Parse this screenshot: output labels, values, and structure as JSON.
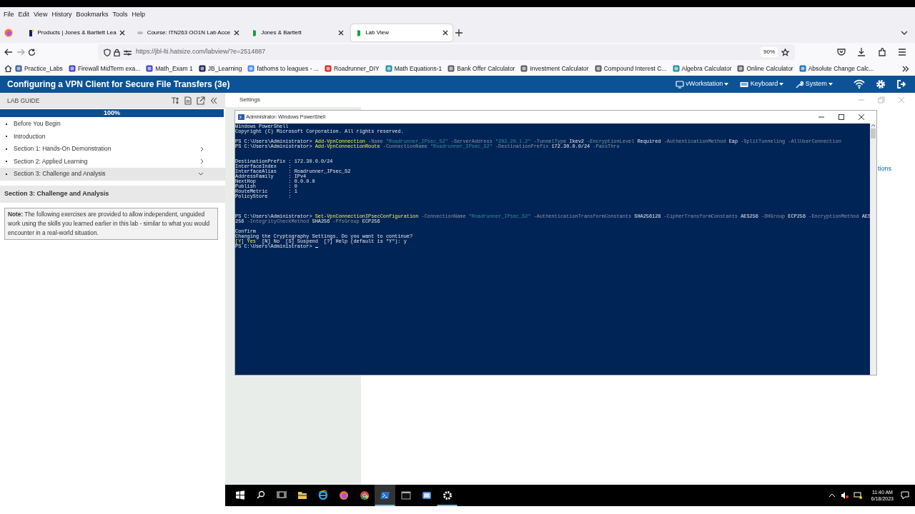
{
  "menu": [
    "File",
    "Edit",
    "View",
    "History",
    "Bookmarks",
    "Tools",
    "Help"
  ],
  "tabs": [
    {
      "title": "Products | Jones & Bartlett Lea",
      "selected": false
    },
    {
      "title": "Course: ITN263 OO1N Lab Acce",
      "selected": false
    },
    {
      "title": "Jones & Bartlett",
      "selected": false
    },
    {
      "title": "Lab View",
      "selected": true
    }
  ],
  "address": {
    "url": "https://jbl-lti.hatsize.com/labview/?e=2514887",
    "zoom": "90%"
  },
  "bookmarks": [
    {
      "label": "Practice_Labs",
      "color": "#3b5ba5"
    },
    {
      "label": "Firewall MidTerm exa...",
      "color": "#3f3fd0"
    },
    {
      "label": "Math_Exam 1",
      "color": "#3f3fd0"
    },
    {
      "label": "JB_Learning",
      "color": "#1a1a5e"
    },
    {
      "label": "fathoms to leagues - ...",
      "color": "#4285f4"
    },
    {
      "label": "Roadrunner_DIY",
      "color": "#e02020"
    },
    {
      "label": "Math Equations-1",
      "color": "#1a8fa8"
    },
    {
      "label": "Bank Offer Calculator",
      "color": "#5a5a66"
    },
    {
      "label": "Investment Calculator",
      "color": "#5a5a66"
    },
    {
      "label": "Compound Interest C...",
      "color": "#5a5a66"
    },
    {
      "label": "Algebra Calculator",
      "color": "#1a8fa8"
    },
    {
      "label": "Online Calculator",
      "color": "#5a5a66"
    },
    {
      "label": "Absolute Change Calc...",
      "color": "#1c6fb5"
    }
  ],
  "lab": {
    "title": "Configuring a VPN Client for Secure File Transfers (3e)",
    "menus": [
      "vWorkstation",
      "Keyboard",
      "System"
    ]
  },
  "guide": {
    "heading": "LAB GUIDE",
    "progress": {
      "level": 1,
      "label": "100%"
    },
    "items": [
      {
        "label": "Before You Begin",
        "expandable": false,
        "selected": false
      },
      {
        "label": "Introduction",
        "expandable": false,
        "selected": false
      },
      {
        "label": "Section 1: Hands-On Demonstration",
        "expandable": true,
        "expanded": false,
        "selected": false
      },
      {
        "label": "Section 2: Applied Learning",
        "expandable": true,
        "expanded": false,
        "selected": false
      },
      {
        "label": "Section 3: Challenge and Analysis",
        "expandable": true,
        "expanded": true,
        "selected": true
      }
    ],
    "section_title": "Section 3: Challenge and Analysis",
    "note": "**Note:** The following exercises are provided to allow independent, unguided work using the skills you learned earlier in this lab - similar to what you would encounter in a real-world situation."
  },
  "settings_window": {
    "title": "Settings",
    "partial_link": "tions"
  },
  "powershell": {
    "title": "Administrator: Windows PowerShell",
    "lines": [
      {
        "kind": "text",
        "segments": [
          {
            "kind": "text",
            "text": "Windows PowerShell"
          }
        ]
      },
      {
        "kind": "text",
        "segments": [
          {
            "kind": "text",
            "text": "Copyright (C) Microsoft Corporation. All rights reserved."
          }
        ]
      },
      {
        "kind": "blank"
      },
      {
        "kind": "text",
        "segments": [
          {
            "kind": "text",
            "text": "PS C:\\Users\\Administrator> "
          },
          {
            "kind": "command",
            "text": "Add-VpnConnection"
          },
          {
            "kind": "parameter",
            "text": " -Name "
          },
          {
            "kind": "string",
            "text": "\"Roadrunner_IPsec_S2\""
          },
          {
            "kind": "parameter",
            "text": " -ServerAddress "
          },
          {
            "kind": "string",
            "text": "\"202.20.1.2\""
          },
          {
            "kind": "parameter",
            "text": " -TunnelType "
          },
          {
            "kind": "text",
            "text": "Ikev2"
          },
          {
            "kind": "parameter",
            "text": " -EncryptionLevel "
          },
          {
            "kind": "text",
            "text": "Required"
          },
          {
            "kind": "parameter",
            "text": " -AuthenticationMethod "
          },
          {
            "kind": "text",
            "text": "Eap"
          },
          {
            "kind": "parameter",
            "text": " -SplitTunneling -AllUserConnection"
          }
        ]
      },
      {
        "kind": "text",
        "segments": [
          {
            "kind": "text",
            "text": "PS C:\\Users\\Administrator> "
          },
          {
            "kind": "command",
            "text": "Add-VpnConnectionRoute"
          },
          {
            "kind": "parameter",
            "text": " -ConnectionName "
          },
          {
            "kind": "string",
            "text": "\"Roadrunner_IPsec_S2\""
          },
          {
            "kind": "parameter",
            "text": " -DestinationPrefix "
          },
          {
            "kind": "text",
            "text": "172.30.0.0/24"
          },
          {
            "kind": "parameter",
            "text": " -PassThru"
          }
        ]
      },
      {
        "kind": "blank"
      },
      {
        "kind": "blank"
      },
      {
        "kind": "text",
        "segments": [
          {
            "kind": "text",
            "text": "DestinationPrefix : 172.30.0.0/24"
          }
        ]
      },
      {
        "kind": "text",
        "segments": [
          {
            "kind": "text",
            "text": "InterfaceIndex    :"
          }
        ]
      },
      {
        "kind": "text",
        "segments": [
          {
            "kind": "text",
            "text": "InterfaceAlias    : Roadrunner_IPsec_S2"
          }
        ]
      },
      {
        "kind": "text",
        "segments": [
          {
            "kind": "text",
            "text": "AddressFamily     : IPv4"
          }
        ]
      },
      {
        "kind": "text",
        "segments": [
          {
            "kind": "text",
            "text": "NextHop           : 0.0.0.0"
          }
        ]
      },
      {
        "kind": "text",
        "segments": [
          {
            "kind": "text",
            "text": "Publish           : 0"
          }
        ]
      },
      {
        "kind": "text",
        "segments": [
          {
            "kind": "text",
            "text": "RouteMetric       : 1"
          }
        ]
      },
      {
        "kind": "text",
        "segments": [
          {
            "kind": "text",
            "text": "PolicyStore       :"
          }
        ]
      },
      {
        "kind": "blank"
      },
      {
        "kind": "blank"
      },
      {
        "kind": "blank"
      },
      {
        "kind": "text",
        "segments": [
          {
            "kind": "text",
            "text": "PS C:\\Users\\Administrator> "
          },
          {
            "kind": "command",
            "text": "Set-VpnConnectionIPsecConfiguration"
          },
          {
            "kind": "parameter",
            "text": " -ConnectionName "
          },
          {
            "kind": "string",
            "text": "\"Roadrunner_IPsec_S2\""
          },
          {
            "kind": "parameter",
            "text": " -AuthenticationTransformConstants "
          },
          {
            "kind": "text",
            "text": "SHA256128"
          },
          {
            "kind": "parameter",
            "text": " -CipherTransformConstants "
          },
          {
            "kind": "text",
            "text": "AES256"
          },
          {
            "kind": "parameter",
            "text": " -DHGroup "
          },
          {
            "kind": "text",
            "text": "ECP256"
          },
          {
            "kind": "parameter",
            "text": " -EncryptionMethod "
          },
          {
            "kind": "text",
            "text": "AES"
          }
        ]
      },
      {
        "kind": "text",
        "segments": [
          {
            "kind": "text",
            "text": "256"
          },
          {
            "kind": "parameter",
            "text": " -IntegrityCheckMethod "
          },
          {
            "kind": "text",
            "text": "SHA256"
          },
          {
            "kind": "parameter",
            "text": " -PfsGroup "
          },
          {
            "kind": "text",
            "text": "ECP256"
          }
        ]
      },
      {
        "kind": "blank"
      },
      {
        "kind": "text",
        "segments": [
          {
            "kind": "text",
            "text": "Confirm"
          }
        ]
      },
      {
        "kind": "text",
        "segments": [
          {
            "kind": "text",
            "text": "Changing the Cryptography Settings. Do you want to continue?"
          }
        ]
      },
      {
        "kind": "text",
        "segments": [
          {
            "kind": "command",
            "text": "[Y] Yes"
          },
          {
            "kind": "text",
            "text": "  [N] No  [S] Suspend  [?] Help (default is \"Y\"): y"
          }
        ]
      },
      {
        "kind": "prompt",
        "segments": [
          {
            "kind": "text",
            "text": "PS C:\\Users\\Administrator> "
          }
        ]
      }
    ]
  },
  "taskbar": {
    "apps": [
      {
        "kind": "start",
        "active": false,
        "running": false
      },
      {
        "kind": "search",
        "active": false,
        "running": false
      },
      {
        "kind": "taskview",
        "active": false,
        "running": false
      },
      {
        "kind": "explorer",
        "active": false,
        "running": false
      },
      {
        "kind": "ie",
        "active": false,
        "running": false
      },
      {
        "kind": "firefox",
        "active": false,
        "running": false
      },
      {
        "kind": "chrome",
        "active": false,
        "running": false
      },
      {
        "kind": "powershell",
        "active": true,
        "running": true
      },
      {
        "kind": "cmd",
        "active": false,
        "running": false
      },
      {
        "kind": "app",
        "active": false,
        "running": false
      },
      {
        "kind": "settings",
        "active": false,
        "running": true
      }
    ],
    "time": "11:40 AM",
    "date": "6/18/2023"
  }
}
